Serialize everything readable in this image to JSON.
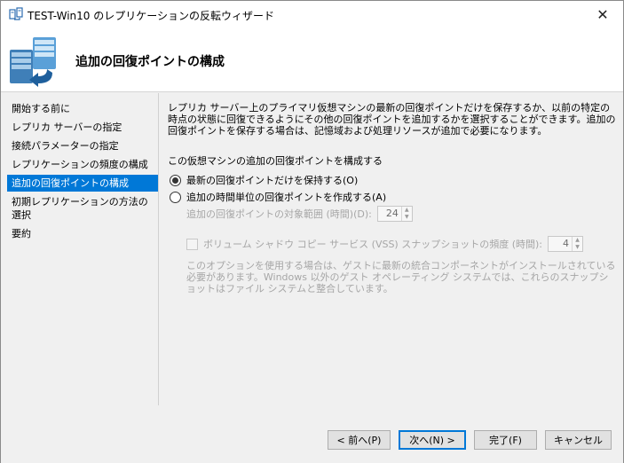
{
  "window": {
    "title": "TEST-Win10 のレプリケーションの反転ウィザード",
    "close_glyph": "✕"
  },
  "header": {
    "title": "追加の回復ポイントの構成"
  },
  "sidebar": {
    "items": [
      {
        "label": "開始する前に",
        "active": false
      },
      {
        "label": "レプリカ サーバーの指定",
        "active": false
      },
      {
        "label": "接続パラメーターの指定",
        "active": false
      },
      {
        "label": "レプリケーションの頻度の構成",
        "active": false
      },
      {
        "label": "追加の回復ポイントの構成",
        "active": true
      },
      {
        "label": "初期レプリケーションの方法の選択",
        "active": false
      },
      {
        "label": "要約",
        "active": false
      }
    ]
  },
  "main": {
    "description": "レプリカ サーバー上のプライマリ仮想マシンの最新の回復ポイントだけを保存するか、以前の特定の時点の状態に回復できるようにその他の回復ポイントを追加するかを選択することができます。追加の回復ポイントを保存する場合は、記憶域および処理リソースが追加で必要になります。",
    "section_label": "この仮想マシンの追加の回復ポイントを構成する",
    "option_latest": {
      "label": "最新の回復ポイントだけを保持する(O)",
      "selected": true
    },
    "option_hourly": {
      "label": "追加の時間単位の回復ポイントを作成する(A)",
      "selected": false
    },
    "coverage": {
      "label": "追加の回復ポイントの対象範囲 (時間)(D):",
      "value": "24"
    },
    "vss": {
      "label": "ボリューム シャドウ コピー サービス (VSS) スナップショットの頻度 (時間):",
      "value": "4",
      "checked": false
    },
    "note": "このオプションを使用する場合は、ゲストに最新の統合コンポーネントがインストールされている必要があります。Windows 以外のゲスト オペレーティング システムでは、これらのスナップショットはファイル システムと整合しています。"
  },
  "footer": {
    "back_label": "< 前へ(P)",
    "next_label": "次へ(N) >",
    "finish_label": "完了(F)",
    "cancel_label": "キャンセル"
  },
  "colors": {
    "accent": "#0078d7",
    "disabled_text": "#a6a6a6",
    "dialog_bg": "#f0f0f0"
  },
  "icons": {
    "title_icon": "replication-icon",
    "header_icon": "replication-servers-icon"
  }
}
